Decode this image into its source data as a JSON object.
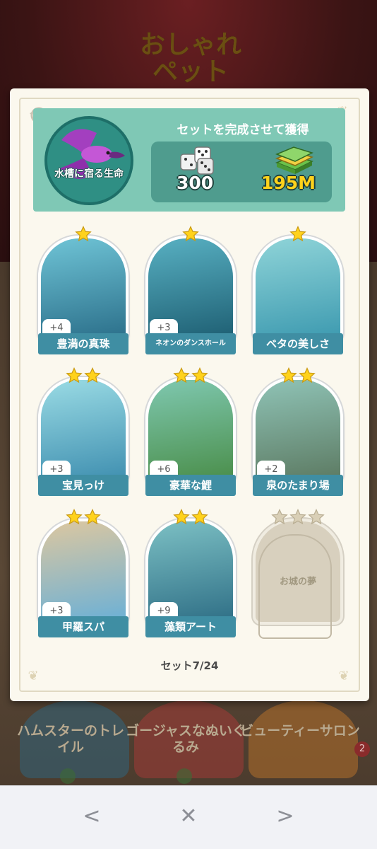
{
  "background": {
    "title": "おしゃれペット",
    "cards": [
      {
        "label": "ハムスターのトレイル"
      },
      {
        "label": "ゴージャスなぬいぐるみ"
      },
      {
        "label": "ビューティーサロン"
      }
    ],
    "badge": "2"
  },
  "reward_panel": {
    "set_name": "水槽に宿る生命",
    "title": "セットを完成させて獲得",
    "dice_amount": "300",
    "money_amount": "195M"
  },
  "cards": [
    {
      "name": "豊満の真珠",
      "count": "+4",
      "stars": 1,
      "locked": false
    },
    {
      "name": "ネオンのダンスホール",
      "count": "+3",
      "stars": 1,
      "locked": false
    },
    {
      "name": "ベタの美しさ",
      "count": "",
      "stars": 1,
      "locked": false
    },
    {
      "name": "宝見っけ",
      "count": "+3",
      "stars": 2,
      "locked": false
    },
    {
      "name": "豪華な鯉",
      "count": "+6",
      "stars": 2,
      "locked": false
    },
    {
      "name": "泉のたまり場",
      "count": "+2",
      "stars": 2,
      "locked": false
    },
    {
      "name": "甲羅スパ",
      "count": "+3",
      "stars": 2,
      "locked": false
    },
    {
      "name": "藻類アート",
      "count": "+9",
      "stars": 2,
      "locked": false
    },
    {
      "name": "お城の夢",
      "count": "",
      "stars": 3,
      "locked": true
    }
  ],
  "progress": "セット7/24",
  "nav": {
    "back": "<",
    "close": "✕",
    "forward": ">"
  },
  "colors": {
    "panel": "#7fc8b5",
    "label": "#3f8ea3",
    "star": "#ffd21c",
    "money": "#ffd21c"
  },
  "icons": {
    "history": "history-icon",
    "dice": "dice-icon",
    "cash": "cash-stack-icon",
    "star": "star-icon"
  }
}
